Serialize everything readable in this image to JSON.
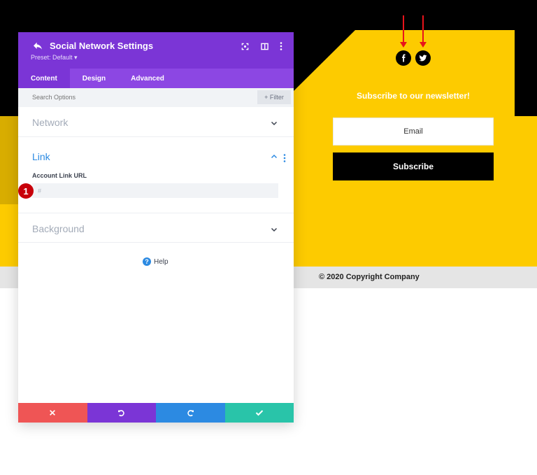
{
  "site": {
    "newsletter_title": "Subscribe to our newsletter!",
    "email_placeholder": "Email",
    "subscribe_label": "Subscribe",
    "copyright": "© 2020 Copyright Company",
    "social_icons": [
      "facebook-icon",
      "twitter-icon"
    ]
  },
  "modal": {
    "title": "Social Network Settings",
    "preset": "Preset: Default ▾",
    "tabs": [
      {
        "label": "Content",
        "active": true
      },
      {
        "label": "Design",
        "active": false
      },
      {
        "label": "Advanced",
        "active": false
      }
    ],
    "search_placeholder": "Search Options",
    "filter_label": "+ Filter",
    "sections": {
      "network": "Network",
      "link": "Link",
      "background": "Background"
    },
    "link": {
      "field_label": "Account Link URL",
      "url_value": "#"
    },
    "step_badge": "1",
    "help_label": "Help"
  },
  "colors": {
    "header": "#7b35d6",
    "tabs": "#8c47e3",
    "yellow": "#fdcb00",
    "cancel": "#ef5555",
    "undo": "#7b35d6",
    "redo": "#2c8ae2",
    "save": "#29c4a9",
    "link_active": "#2c8ae2"
  }
}
